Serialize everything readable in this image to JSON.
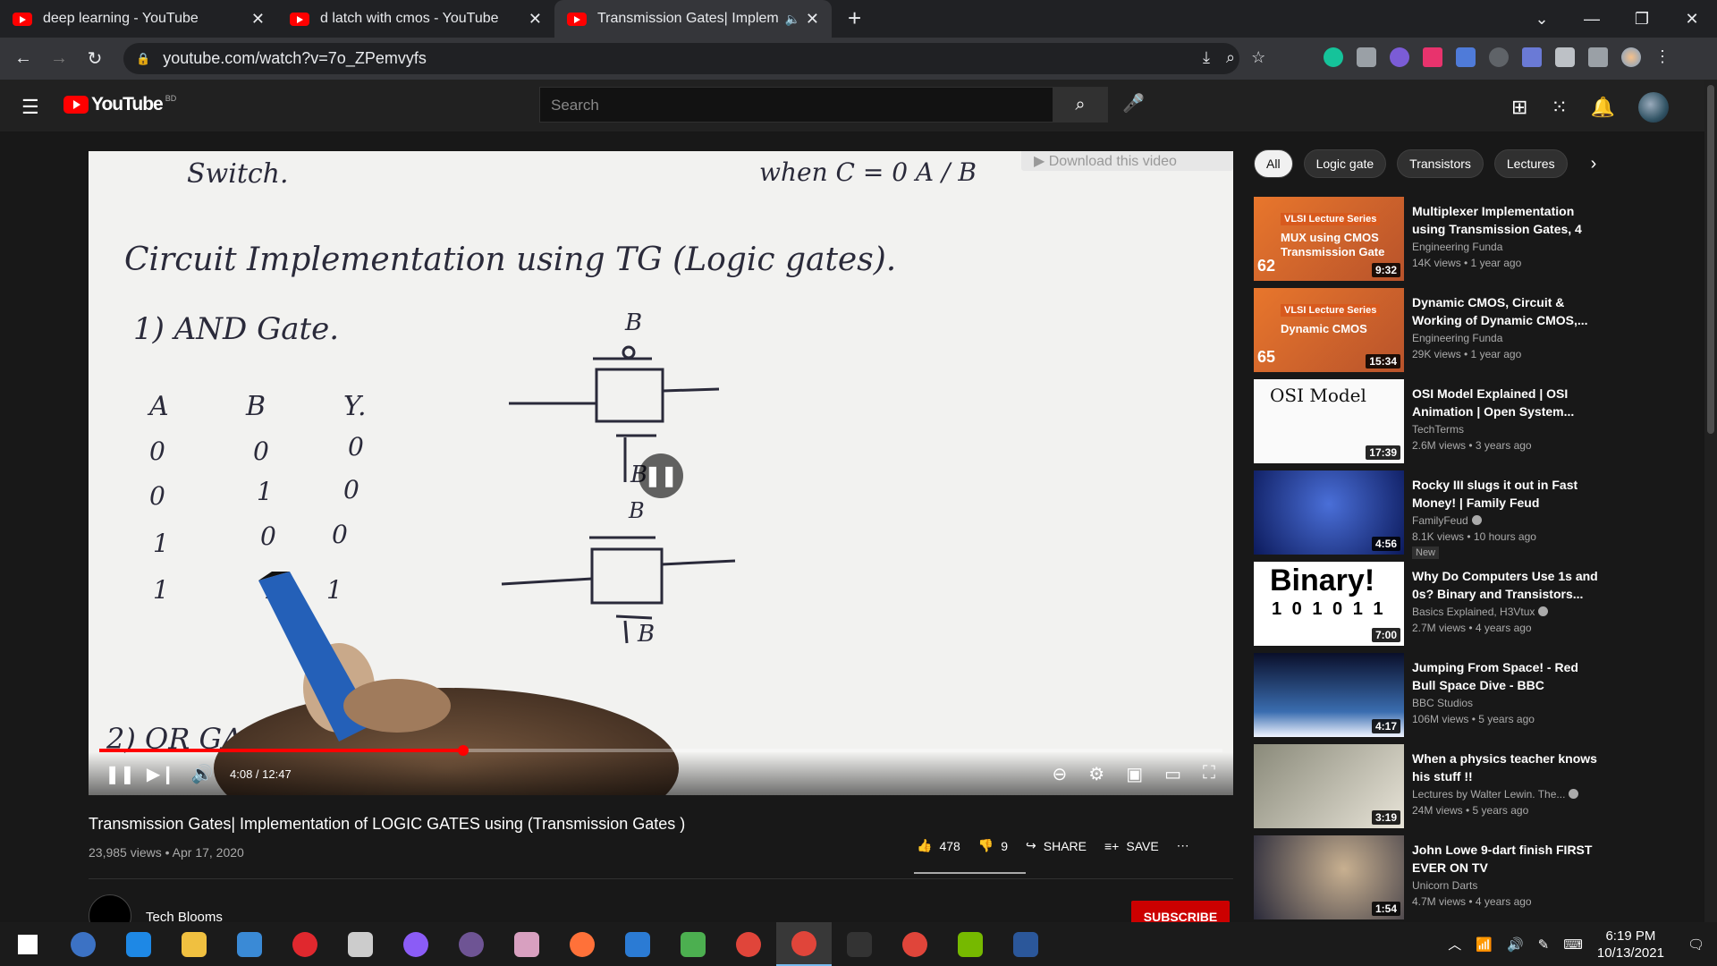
{
  "browser": {
    "tabs": [
      {
        "title": "deep learning - YouTube",
        "active": false,
        "audio": false
      },
      {
        "title": "d latch with cmos - YouTube",
        "active": false,
        "audio": false
      },
      {
        "title": "Transmission Gates| Impleme",
        "active": true,
        "audio": true
      }
    ],
    "url": "youtube.com/watch?v=7o_ZPemvyfs"
  },
  "youtube": {
    "logo_text": "YouTube",
    "country": "BD",
    "search_placeholder": "Search"
  },
  "player": {
    "download_banner": "▶ Download this video",
    "current_time": "4:08",
    "duration": "12:47",
    "time_label": "4:08 / 12:47",
    "progress_fraction": 0.324,
    "state": "playing",
    "board": {
      "line1": "Switch.",
      "line1b": "when C = 0     A / B",
      "heading": "Circuit Implementation using TG (Logic gates).",
      "item1": "1) AND Gate.",
      "cols": [
        "A",
        "B",
        "Y."
      ],
      "rows": [
        [
          "0",
          "0",
          "0"
        ],
        [
          "0",
          "1",
          "0"
        ],
        [
          "1",
          "0",
          "0"
        ],
        [
          "1",
          "1",
          "1"
        ]
      ],
      "item2": "2) OR GA",
      "tg_labels": [
        "B",
        "B",
        "B",
        "B"
      ]
    }
  },
  "video": {
    "title": "Transmission Gates| Implementation of LOGIC GATES using (Transmission Gates )",
    "views": "23,985 views",
    "date": "Apr 17, 2020",
    "likes": "478",
    "dislikes": "9",
    "share": "SHARE",
    "save": "SAVE",
    "channel": "Tech Blooms",
    "subscribe": "SUBSCRIBE"
  },
  "chips": [
    "All",
    "Logic gate",
    "Transistors",
    "Lectures"
  ],
  "recommendations": [
    {
      "title": "Multiplexer Implementation using Transmission Gates, 4 t...",
      "channel": "Engineering Funda",
      "meta": "14K views • 1 year ago",
      "duration": "9:32",
      "verified": false,
      "new": false,
      "thumb": "vlsi1",
      "thumb_text": [
        "VLSI Lecture Series",
        "MUX using CMOS",
        "Transmission Gate",
        "62"
      ]
    },
    {
      "title": "Dynamic CMOS, Circuit & Working of Dynamic CMOS,...",
      "channel": "Engineering Funda",
      "meta": "29K views • 1 year ago",
      "duration": "15:34",
      "verified": false,
      "new": false,
      "thumb": "vlsi2",
      "thumb_text": [
        "VLSI Lecture Series",
        "Dynamic CMOS",
        "",
        "65"
      ]
    },
    {
      "title": "OSI Model Explained | OSI Animation | Open System...",
      "channel": "TechTerms",
      "meta": "2.6M views • 3 years ago",
      "duration": "17:39",
      "verified": false,
      "new": false,
      "thumb": "osi",
      "thumb_text": [
        "OSI Model"
      ]
    },
    {
      "title": "Rocky III slugs it out in Fast Money! | Family Feud",
      "channel": "FamilyFeud",
      "meta": "8.1K views • 10 hours ago",
      "duration": "4:56",
      "verified": true,
      "new": true,
      "new_label": "New",
      "thumb": "feud"
    },
    {
      "title": "Why Do Computers Use 1s and 0s? Binary and Transistors...",
      "channel": "Basics Explained, H3Vtux",
      "meta": "2.7M views • 4 years ago",
      "duration": "7:00",
      "verified": true,
      "new": false,
      "thumb": "binary",
      "thumb_text": [
        "Binary!",
        "1 0 1 0 1 1"
      ]
    },
    {
      "title": "Jumping From Space! - Red Bull Space Dive - BBC",
      "channel": "BBC Studios",
      "meta": "106M views • 5 years ago",
      "duration": "4:17",
      "verified": false,
      "new": false,
      "thumb": "space"
    },
    {
      "title": "When a physics teacher knows his stuff !!",
      "channel": "Lectures by Walter Lewin. The...",
      "meta": "24M views • 5 years ago",
      "duration": "3:19",
      "verified": true,
      "new": false,
      "thumb": "physics"
    },
    {
      "title": "John Lowe 9-dart finish FIRST EVER ON TV",
      "channel": "Unicorn Darts",
      "meta": "4.7M views • 4 years ago",
      "duration": "1:54",
      "verified": false,
      "new": false,
      "thumb": "darts"
    }
  ],
  "taskbar": {
    "time": "6:19 PM",
    "date": "10/13/2021",
    "apps": [
      "start",
      "qb",
      "edge",
      "explorer",
      "mail",
      "opera",
      "inkscape",
      "messenger",
      "github",
      "pinwheel",
      "firefox",
      "vscode",
      "globe",
      "chrome",
      "chrome-active",
      "terminal",
      "chrome-dev",
      "nvidia",
      "word"
    ]
  }
}
